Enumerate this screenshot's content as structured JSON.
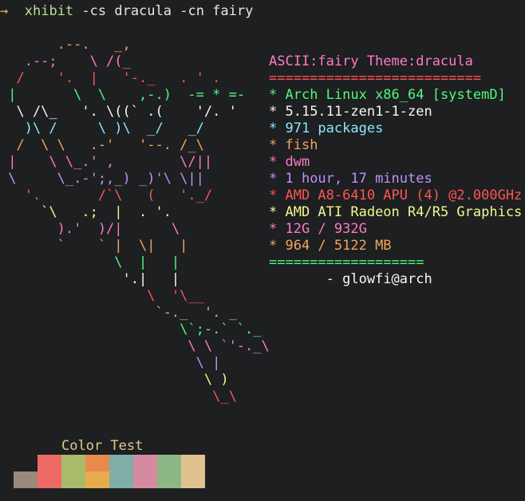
{
  "terminal": {
    "prompt_arrow": "→",
    "command_bin": "xhibit",
    "command_args": "-cs dracula -cn fairy"
  },
  "art": {
    "lines": [
      {
        "text": "       .--.   _,",
        "color": "#f0a65a"
      },
      {
        "text": "   .--;    \\ /(_",
        "color": "#ff79c6"
      },
      {
        "text": "  /    '.  |   '-._   . ' .",
        "color": "#ff5555"
      },
      {
        "text": " |       \\  \\    ,-.)  -= * =-",
        "color": "#50fa7b"
      },
      {
        "text": "  \\ /\\_   '. \\((` .(    '/. '",
        "color": "#f8f8f2"
      },
      {
        "text": "   )\\ /     \\ )\\  _/   _/",
        "color": "#8be9fd"
      },
      {
        "text": "  /  \\ \\   .-'   '--. /_\\",
        "color": "#f0a65a"
      },
      {
        "text": " |    \\ \\_.' ,        \\/||",
        "color": "#ff79c6"
      },
      {
        "text": " \\     \\_.-';,_) _)'\\ \\||",
        "color": "#bd93f9"
      },
      {
        "text": "   '.       /`\\   (   '._/",
        "color": "#ff5555"
      },
      {
        "text": "     `\\   .;  |  . '.",
        "color": "#f1fa8c"
      },
      {
        "text": "       ).'  )/|      \\",
        "color": "#ff79c6"
      },
      {
        "text": "       `    ` |  \\|   |",
        "color": "#f0a65a"
      },
      {
        "text": "              \\  |   |",
        "color": "#50fa7b"
      },
      {
        "text": "               '.|   |",
        "color": "#f8f8f2"
      },
      {
        "text": "                  \\  '\\__",
        "color": "#ff5555"
      },
      {
        "text": "                   `-._  '. _",
        "color": "#f0a65a"
      },
      {
        "text": "                      \\`;-.` `._",
        "color": "#50fa7b"
      },
      {
        "text": "                       \\ \\ `'-._\\",
        "color": "#ff79c6"
      },
      {
        "text": "                        \\ |",
        "color": "#bd93f9"
      },
      {
        "text": "                         \\ )",
        "color": "#f1fa8c"
      },
      {
        "text": "                          \\_\\",
        "color": "#ff5555"
      }
    ]
  },
  "info": {
    "lines": [
      {
        "text": "ASCII:fairy Theme:dracula",
        "color": "#ff79c6",
        "star": ""
      },
      {
        "text": "==========================",
        "color": "#ff5555",
        "star": ""
      },
      {
        "text": "Arch Linux x86_64 [systemD]",
        "color": "#50fa7b",
        "star": "* "
      },
      {
        "text": "5.15.11-zen1-1-zen",
        "color": "#f8f8f2",
        "star": "* "
      },
      {
        "text": "971 packages",
        "color": "#8be9fd",
        "star": "* "
      },
      {
        "text": "fish",
        "color": "#f0a65a",
        "star": "* "
      },
      {
        "text": "dwm",
        "color": "#ff79c6",
        "star": "* "
      },
      {
        "text": "1 hour, 17 minutes",
        "color": "#bd93f9",
        "star": "* "
      },
      {
        "text": "AMD A8-6410 APU (4) @2.000GHz",
        "color": "#ff5555",
        "star": "* "
      },
      {
        "text": "AMD ATI Radeon R4/R5 Graphics",
        "color": "#f1fa8c",
        "star": "* "
      },
      {
        "text": "12G / 932G",
        "color": "#ff79c6",
        "star": "* "
      },
      {
        "text": "964 / 5122 MB",
        "color": "#f0a65a",
        "star": "* "
      },
      {
        "text": "===================",
        "color": "#50fa7b",
        "star": ""
      },
      {
        "text": "       - glowfi@arch",
        "color": "#f8f8f2",
        "star": ""
      }
    ]
  },
  "palette": {
    "label": "Color Test",
    "top_row": [
      "#1d1f21",
      "#ee6a64",
      "#a9bb68",
      "#e8894e",
      "#7fada7",
      "#d68aa0",
      "#8bb884",
      "#e0c291"
    ],
    "bottom_row": [
      "#9b8878",
      "#ee6a64",
      "#a9bb68",
      "#e7ab4c",
      "#7fada7",
      "#d68aa0",
      "#8bb884",
      "#e0c291"
    ]
  }
}
